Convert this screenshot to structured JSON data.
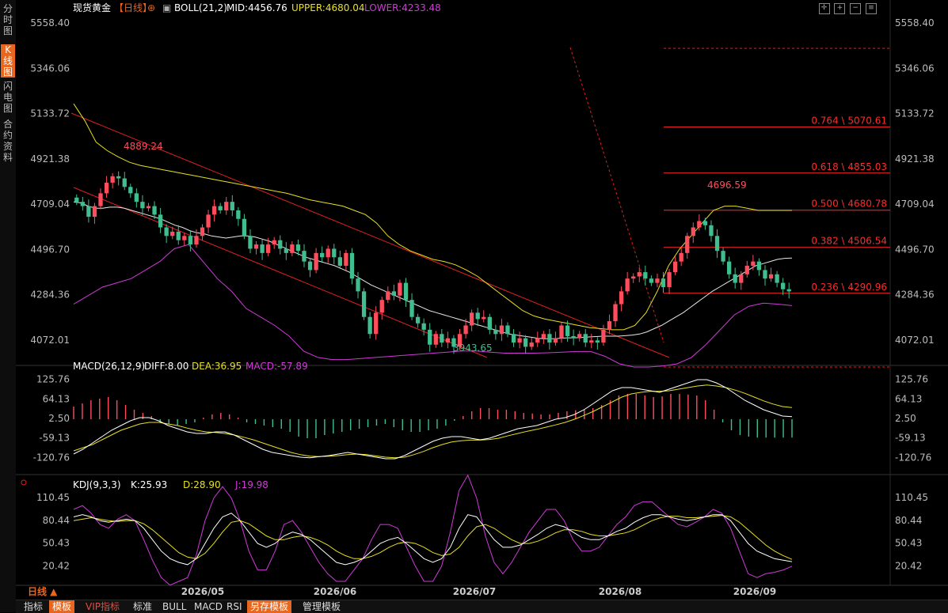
{
  "sidebar": {
    "tabs": [
      "分\n时\n图",
      "K\n线\n图",
      "闪\n电\n图",
      "合\n约\n资\n料"
    ],
    "active_index": 1
  },
  "header": {
    "title": "现货黄金",
    "period": "【日线】",
    "boll_label": "BOLL(21,2)",
    "mid": "MID:4456.76",
    "upper": "UPPER:4680.04",
    "lower": "LOWER:4233.48"
  },
  "period_selector": "日线",
  "bottom_tabs": [
    "指标",
    "模板",
    "VIP指标",
    "标准",
    "BULL",
    "MACD",
    "RSI",
    "另存模板",
    "管理模板"
  ],
  "colors": {
    "up": "#ff4d5e",
    "down": "#3fbf8f",
    "mid": "#e8e8e8",
    "upper": "#e8e020",
    "lower": "#d03ad8",
    "fib": "#ff2a2a",
    "accent": "#e8661e"
  },
  "chart_data": [
    {
      "type": "candlestick",
      "title": "现货黄金【日线】",
      "ylim": [
        3960,
        5600
      ],
      "y_ticks": [
        "5558.40",
        "5346.06",
        "5133.72",
        "4921.38",
        "4709.04",
        "4496.70",
        "4284.36",
        "4072.01"
      ],
      "x_ticks": [
        "2026/05",
        "2026/06",
        "2026/07",
        "2026/08",
        "2026/09"
      ],
      "annotations": {
        "high": "4889.24",
        "low": "3943.65",
        "recent_high": "4696.59"
      },
      "fib_levels": [
        {
          "label": "0.764 \\ 5070.61",
          "value": 5070.61
        },
        {
          "label": "0.618 \\ 4855.03",
          "value": 4855.03
        },
        {
          "label": "0.500 \\ 4680.78",
          "value": 4680.78
        },
        {
          "label": "0.382 \\ 4506.54",
          "value": 4506.54
        },
        {
          "label": "0.236 \\ 4290.96",
          "value": 4290.96
        }
      ],
      "fib_range_dashed": [
        5440,
        3945
      ],
      "candles_close": [
        4720,
        4700,
        4650,
        4700,
        4760,
        4810,
        4840,
        4830,
        4790,
        4760,
        4720,
        4690,
        4700,
        4660,
        4600,
        4560,
        4580,
        4540,
        4560,
        4520,
        4560,
        4600,
        4660,
        4700,
        4680,
        4720,
        4680,
        4640,
        4560,
        4500,
        4520,
        4480,
        4520,
        4540,
        4500,
        4480,
        4520,
        4490,
        4440,
        4400,
        4480,
        4460,
        4500,
        4460,
        4420,
        4480,
        4360,
        4300,
        4180,
        4100,
        4200,
        4260,
        4300,
        4280,
        4340,
        4260,
        4180,
        4150,
        4120,
        4050,
        4100,
        4060,
        4080,
        4040,
        4100,
        4140,
        4200,
        4170,
        4180,
        4120,
        4100,
        4140,
        4100,
        4060,
        4080,
        4040,
        4060,
        4080,
        4100,
        4060,
        4080,
        4140,
        4090,
        4080,
        4100,
        4060,
        4070,
        4060,
        4120,
        4160,
        4240,
        4300,
        4360,
        4370,
        4390,
        4360,
        4340,
        4360,
        4320,
        4390,
        4440,
        4480,
        4560,
        4600,
        4630,
        4610,
        4560,
        4490,
        4440,
        4380,
        4340,
        4380,
        4420,
        4440,
        4400,
        4360,
        4380,
        4340,
        4310,
        4300
      ],
      "boll_mid": [
        4720,
        4715,
        4700,
        4690,
        4690,
        4695,
        4695,
        4690,
        4680,
        4670,
        4660,
        4650,
        4640,
        4625,
        4610,
        4600,
        4585,
        4575,
        4570,
        4560,
        4555,
        4550,
        4555,
        4560,
        4560,
        4555,
        4545,
        4535,
        4520,
        4505,
        4490,
        4475,
        4460,
        4450,
        4440,
        4430,
        4420,
        4405,
        4390,
        4370,
        4350,
        4330,
        4315,
        4300,
        4285,
        4270,
        4255,
        4240,
        4225,
        4210,
        4200,
        4190,
        4180,
        4170,
        4160,
        4150,
        4140,
        4130,
        4120,
        4110,
        4100,
        4095,
        4090,
        4085,
        4080,
        4078,
        4078,
        4080,
        4082,
        4082,
        4084,
        4086,
        4088,
        4090,
        4090,
        4090,
        4092,
        4095,
        4100,
        4110,
        4125,
        4140,
        4160,
        4180,
        4200,
        4225,
        4250,
        4275,
        4300,
        4320,
        4340,
        4360,
        4380,
        4400,
        4420,
        4430,
        4440,
        4450,
        4455,
        4456
      ],
      "boll_upper": [
        5180,
        5100,
        5000,
        4960,
        4930,
        4905,
        4890,
        4880,
        4870,
        4860,
        4850,
        4840,
        4830,
        4820,
        4810,
        4800,
        4790,
        4780,
        4770,
        4760,
        4745,
        4730,
        4720,
        4710,
        4700,
        4680,
        4660,
        4620,
        4560,
        4520,
        4490,
        4470,
        4450,
        4440,
        4425,
        4400,
        4370,
        4330,
        4290,
        4250,
        4210,
        4185,
        4170,
        4160,
        4150,
        4140,
        4130,
        4125,
        4120,
        4120,
        4140,
        4200,
        4300,
        4420,
        4500,
        4560,
        4620,
        4680,
        4700,
        4700,
        4690,
        4680,
        4680,
        4680,
        4680
      ],
      "boll_lower": [
        4240,
        4280,
        4320,
        4340,
        4360,
        4400,
        4440,
        4500,
        4520,
        4440,
        4360,
        4300,
        4220,
        4180,
        4140,
        4090,
        4020,
        3990,
        3980,
        3980,
        3985,
        3990,
        3995,
        4000,
        4005,
        4010,
        4015,
        4020,
        4020,
        4015,
        4010,
        4010,
        4010,
        4012,
        4015,
        4018,
        4018,
        3995,
        3960,
        3945,
        3945,
        3950,
        3960,
        3990,
        4050,
        4120,
        4190,
        4230,
        4245,
        4240,
        4233
      ]
    },
    {
      "type": "line",
      "title": "MACD(26,12,9)",
      "series": [
        {
          "name": "DIFF",
          "last": "DIFF:8.00"
        },
        {
          "name": "DEA",
          "last": "DEA:36.95"
        },
        {
          "name": "MACD",
          "last": "MACD:-57.89"
        }
      ],
      "y_ticks": [
        "125.76",
        "64.13",
        "2.50",
        "-59.13",
        "-120.76"
      ],
      "ylim": [
        -150,
        150
      ],
      "diff": [
        -110,
        -95,
        -75,
        -55,
        -35,
        -20,
        -5,
        5,
        5,
        -5,
        -20,
        -30,
        -40,
        -45,
        -45,
        -40,
        -40,
        -50,
        -65,
        -80,
        -95,
        -105,
        -110,
        -115,
        -120,
        -122,
        -118,
        -115,
        -110,
        -105,
        -110,
        -115,
        -120,
        -125,
        -125,
        -115,
        -100,
        -85,
        -70,
        -60,
        -55,
        -55,
        -60,
        -65,
        -60,
        -50,
        -40,
        -30,
        -25,
        -20,
        -10,
        0,
        5,
        15,
        30,
        50,
        70,
        90,
        100,
        100,
        95,
        90,
        85,
        95,
        105,
        115,
        125,
        125,
        115,
        100,
        80,
        60,
        45,
        30,
        20,
        10,
        8
      ],
      "dea": [
        -100,
        -90,
        -80,
        -65,
        -50,
        -35,
        -25,
        -15,
        -10,
        -10,
        -15,
        -20,
        -28,
        -35,
        -40,
        -42,
        -45,
        -50,
        -57,
        -65,
        -75,
        -85,
        -95,
        -105,
        -112,
        -117,
        -118,
        -117,
        -115,
        -112,
        -110,
        -112,
        -116,
        -120,
        -122,
        -120,
        -112,
        -102,
        -90,
        -80,
        -72,
        -68,
        -66,
        -66,
        -64,
        -60,
        -52,
        -45,
        -38,
        -32,
        -25,
        -18,
        -10,
        0,
        12,
        25,
        40,
        55,
        70,
        80,
        85,
        88,
        88,
        90,
        95,
        100,
        105,
        108,
        105,
        100,
        92,
        82,
        70,
        58,
        48,
        40,
        36.95
      ],
      "macd_hist": [
        40,
        50,
        60,
        65,
        70,
        60,
        45,
        30,
        20,
        10,
        -10,
        -15,
        -20,
        -15,
        -10,
        5,
        15,
        20,
        15,
        5,
        -10,
        -15,
        -20,
        -25,
        -30,
        -40,
        -55,
        -60,
        -60,
        -50,
        -45,
        -40,
        -35,
        -30,
        -25,
        -20,
        -15,
        -25,
        -35,
        -40,
        -40,
        -35,
        -30,
        -20,
        -5,
        10,
        25,
        35,
        35,
        30,
        30,
        25,
        20,
        18,
        15,
        15,
        20,
        25,
        28,
        30,
        35,
        45,
        60,
        75,
        80,
        80,
        75,
        70,
        72,
        80,
        80,
        78,
        75,
        60,
        30,
        -10,
        -35,
        -50,
        -55,
        -58,
        -58,
        -58,
        -58,
        -58
      ]
    },
    {
      "type": "line",
      "title": "KDJ(9,3,3)",
      "series": [
        {
          "name": "K",
          "last": "K:25.93"
        },
        {
          "name": "D",
          "last": "D:28.90"
        },
        {
          "name": "J",
          "last": "J:19.98"
        }
      ],
      "y_ticks": [
        "110.45",
        "80.44",
        "50.43",
        "20.42"
      ],
      "ylim": [
        0,
        120
      ],
      "k": [
        85,
        88,
        85,
        80,
        78,
        80,
        82,
        80,
        70,
        55,
        40,
        30,
        25,
        22,
        30,
        50,
        70,
        85,
        90,
        80,
        65,
        50,
        45,
        50,
        60,
        65,
        62,
        55,
        45,
        35,
        25,
        22,
        25,
        30,
        40,
        50,
        55,
        58,
        50,
        40,
        30,
        25,
        30,
        45,
        70,
        88,
        85,
        70,
        55,
        45,
        45,
        48,
        55,
        62,
        70,
        75,
        72,
        65,
        58,
        55,
        55,
        60,
        66,
        70,
        78,
        84,
        88,
        88,
        85,
        82,
        80,
        82,
        85,
        88,
        88,
        80,
        65,
        50,
        40,
        35,
        30,
        28,
        26
      ],
      "d": [
        80,
        82,
        84,
        82,
        80,
        79,
        80,
        80,
        76,
        68,
        58,
        48,
        38,
        32,
        30,
        37,
        50,
        65,
        78,
        80,
        76,
        68,
        60,
        55,
        55,
        58,
        60,
        58,
        54,
        48,
        40,
        34,
        30,
        30,
        33,
        38,
        45,
        50,
        52,
        50,
        45,
        38,
        34,
        36,
        45,
        60,
        72,
        75,
        70,
        62,
        55,
        50,
        50,
        53,
        58,
        64,
        68,
        68,
        66,
        62,
        60,
        60,
        62,
        64,
        68,
        74,
        80,
        84,
        86,
        86,
        84,
        84,
        85,
        86,
        87,
        85,
        78,
        68,
        58,
        48,
        40,
        34,
        29
      ],
      "j": [
        95,
        100,
        90,
        75,
        70,
        82,
        88,
        80,
        55,
        28,
        5,
        -5,
        0,
        5,
        35,
        80,
        110,
        125,
        110,
        80,
        40,
        15,
        15,
        40,
        75,
        80,
        65,
        45,
        25,
        10,
        0,
        0,
        15,
        30,
        55,
        75,
        75,
        70,
        45,
        20,
        0,
        0,
        20,
        65,
        120,
        140,
        110,
        60,
        25,
        10,
        25,
        45,
        65,
        80,
        95,
        95,
        80,
        55,
        40,
        40,
        45,
        60,
        75,
        85,
        100,
        105,
        105,
        95,
        85,
        75,
        72,
        78,
        85,
        95,
        90,
        70,
        40,
        10,
        5,
        10,
        12,
        15,
        20
      ]
    }
  ]
}
